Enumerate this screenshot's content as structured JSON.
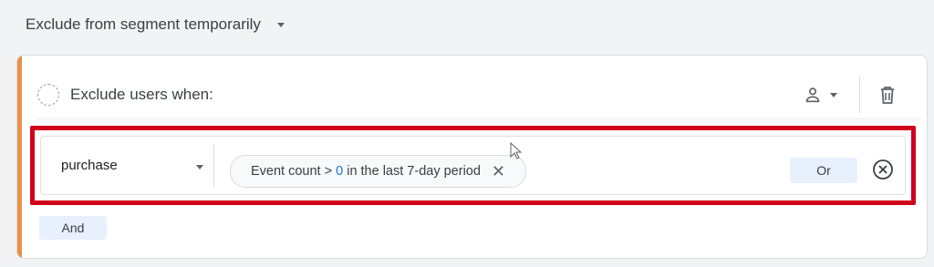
{
  "segment": {
    "scope_label": "Exclude from segment temporarily"
  },
  "condition_group": {
    "header_label": "Exclude users when:",
    "event_name": "purchase",
    "chip": {
      "prefix": "Event count > ",
      "value": "0",
      "suffix": " in the last 7-day period"
    },
    "or_label": "Or",
    "and_label": "And"
  },
  "colors": {
    "accent": "#e8914b",
    "highlight_box": "#d0021b",
    "button_bg": "#e8f0fe",
    "number_blue": "#1a73e8"
  },
  "icons": [
    "dropdown-caret-icon",
    "dashed-circle-icon",
    "person-icon",
    "trash-icon",
    "close-icon",
    "remove-circle-icon",
    "mouse-cursor-icon"
  ]
}
